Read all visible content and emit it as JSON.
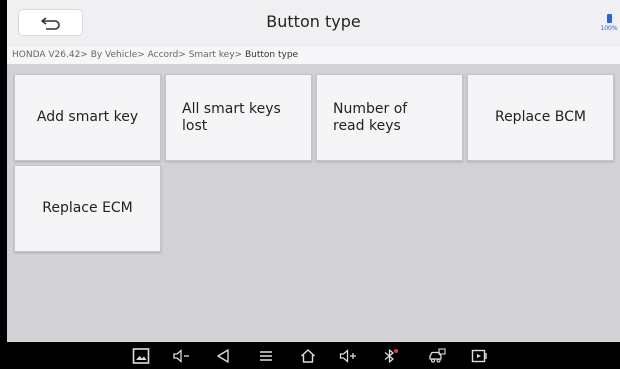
{
  "header": {
    "title": "Button type",
    "battery_text": "100%"
  },
  "breadcrumb": {
    "path": "HONDA V26.42> By Vehicle> Accord> Smart key> ",
    "current": "Button type"
  },
  "tiles": [
    {
      "label": "Add smart key"
    },
    {
      "label": "All smart keys lost"
    },
    {
      "label": "Number of read keys"
    },
    {
      "label": "Replace BCM"
    },
    {
      "label": "Replace ECM"
    }
  ],
  "navbar": {
    "icons": [
      "gallery-icon",
      "volume-down-icon",
      "back-triangle-icon",
      "menu-icon",
      "home-icon",
      "volume-up-icon",
      "bluetooth-icon",
      "vci-car-icon",
      "screen-record-icon"
    ]
  },
  "colors": {
    "accent": "#2c64d8",
    "background": "#d1d1d6",
    "tile": "#f5f5f7"
  }
}
